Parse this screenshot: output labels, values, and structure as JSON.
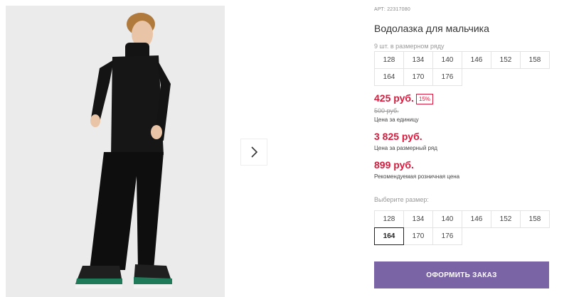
{
  "product": {
    "article": "АРТ: 22317080",
    "title": "Водолазка для мальчика"
  },
  "size_grid": {
    "label": "9 шт. в размерном ряду",
    "sizes": [
      "128",
      "134",
      "140",
      "146",
      "152",
      "158",
      "164",
      "170",
      "176"
    ]
  },
  "pricing": {
    "unit_price": "425 руб.",
    "discount": "15%",
    "old_price": "500 руб.",
    "unit_caption": "Цена за единицу",
    "row_price": "3 825 руб.",
    "row_caption": "Цена за размерный ряд",
    "retail_price": "899 руб.",
    "retail_caption": "Рекомендуемая розничная цена"
  },
  "size_select": {
    "label": "Выберите размер:",
    "sizes": [
      "128",
      "134",
      "140",
      "146",
      "152",
      "158",
      "164",
      "170",
      "176"
    ],
    "selected": "164"
  },
  "actions": {
    "order_label": "ОФОРМИТЬ ЗАКАЗ"
  },
  "gallery": {
    "next_icon": "chevron-right-icon"
  },
  "colors": {
    "price_red": "#d81b3c",
    "order_button": "#7b64a5"
  }
}
